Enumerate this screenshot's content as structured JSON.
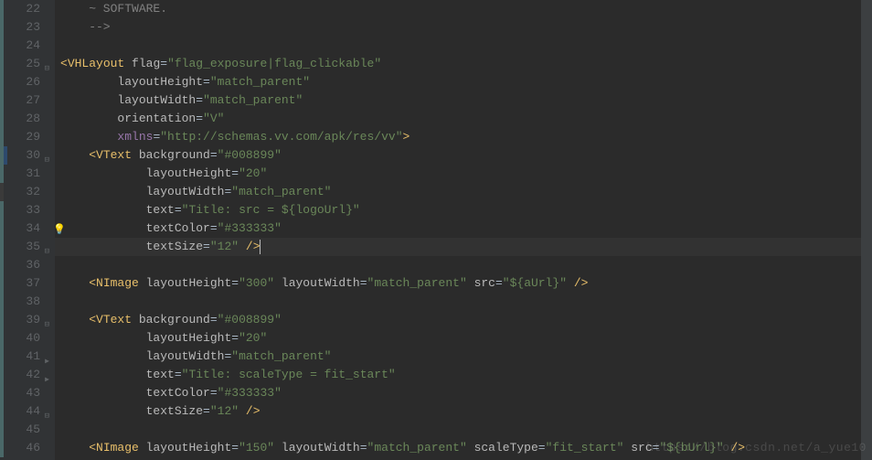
{
  "lines": [
    {
      "num": "22",
      "content": [
        {
          "t": "    ~ SOFTWARE.",
          "c": "comment"
        }
      ],
      "bar": "teal"
    },
    {
      "num": "23",
      "content": [
        {
          "t": "    -->",
          "c": "comment"
        }
      ],
      "bar": "teal"
    },
    {
      "num": "24",
      "content": [
        {
          "t": "",
          "c": ""
        }
      ],
      "bar": "teal"
    },
    {
      "num": "25",
      "content": [
        {
          "t": "<",
          "c": "tag"
        },
        {
          "t": "VHLayout",
          "c": "tag"
        },
        {
          "t": " ",
          "c": ""
        },
        {
          "t": "flag",
          "c": "attr-name"
        },
        {
          "t": "=",
          "c": "attr-eq"
        },
        {
          "t": "\"flag_exposure|flag_clickable\"",
          "c": "attr-val"
        }
      ],
      "bar": "teal",
      "fold": "down"
    },
    {
      "num": "26",
      "content": [
        {
          "t": "        ",
          "c": ""
        },
        {
          "t": "layoutHeight",
          "c": "attr-name"
        },
        {
          "t": "=",
          "c": "attr-eq"
        },
        {
          "t": "\"match_parent\"",
          "c": "attr-val"
        }
      ],
      "bar": "teal"
    },
    {
      "num": "27",
      "content": [
        {
          "t": "        ",
          "c": ""
        },
        {
          "t": "layoutWidth",
          "c": "attr-name"
        },
        {
          "t": "=",
          "c": "attr-eq"
        },
        {
          "t": "\"match_parent\"",
          "c": "attr-val"
        }
      ],
      "bar": "teal"
    },
    {
      "num": "28",
      "content": [
        {
          "t": "        ",
          "c": ""
        },
        {
          "t": "orientation",
          "c": "attr-name"
        },
        {
          "t": "=",
          "c": "attr-eq"
        },
        {
          "t": "\"V\"",
          "c": "attr-val"
        }
      ],
      "bar": "teal"
    },
    {
      "num": "29",
      "content": [
        {
          "t": "        ",
          "c": ""
        },
        {
          "t": "xmlns",
          "c": "ns"
        },
        {
          "t": "=",
          "c": "attr-eq"
        },
        {
          "t": "\"http://schemas.vv.com/apk/res/vv\"",
          "c": "attr-val"
        },
        {
          "t": ">",
          "c": "tag"
        }
      ],
      "bar": "teal"
    },
    {
      "num": "30",
      "content": [
        {
          "t": "    <",
          "c": "tag"
        },
        {
          "t": "VText",
          "c": "tag"
        },
        {
          "t": " ",
          "c": ""
        },
        {
          "t": "background",
          "c": "attr-name"
        },
        {
          "t": "=",
          "c": "attr-eq"
        },
        {
          "t": "\"#008899\"",
          "c": "attr-val"
        }
      ],
      "bar": "teal",
      "bar2": "blue",
      "fold": "down"
    },
    {
      "num": "31",
      "content": [
        {
          "t": "            ",
          "c": ""
        },
        {
          "t": "layoutHeight",
          "c": "attr-name"
        },
        {
          "t": "=",
          "c": "attr-eq"
        },
        {
          "t": "\"20\"",
          "c": "attr-val"
        }
      ],
      "bar": "teal"
    },
    {
      "num": "32",
      "content": [
        {
          "t": "            ",
          "c": ""
        },
        {
          "t": "layoutWidth",
          "c": "attr-name"
        },
        {
          "t": "=",
          "c": "attr-eq"
        },
        {
          "t": "\"match_parent\"",
          "c": "attr-val"
        }
      ],
      "bar": "dark"
    },
    {
      "num": "33",
      "content": [
        {
          "t": "            ",
          "c": ""
        },
        {
          "t": "text",
          "c": "attr-name"
        },
        {
          "t": "=",
          "c": "attr-eq"
        },
        {
          "t": "\"Title: src = ${logoUrl}\"",
          "c": "attr-val"
        }
      ],
      "bar": "teal"
    },
    {
      "num": "34",
      "content": [
        {
          "t": "            ",
          "c": ""
        },
        {
          "t": "textColor",
          "c": "attr-name"
        },
        {
          "t": "=",
          "c": "attr-eq"
        },
        {
          "t": "\"#333333\"",
          "c": "attr-val"
        }
      ],
      "bar": "teal",
      "bulb": true
    },
    {
      "num": "35",
      "content": [
        {
          "t": "            ",
          "c": ""
        },
        {
          "t": "textSize",
          "c": "attr-name"
        },
        {
          "t": "=",
          "c": "attr-eq"
        },
        {
          "t": "\"12\"",
          "c": "attr-val"
        },
        {
          "t": " ",
          "c": ""
        },
        {
          "t": "/>",
          "c": "tag"
        }
      ],
      "bar": "teal",
      "fold": "up",
      "current": true,
      "caret": true
    },
    {
      "num": "36",
      "content": [
        {
          "t": "",
          "c": ""
        }
      ],
      "bar": "teal"
    },
    {
      "num": "37",
      "content": [
        {
          "t": "    <",
          "c": "tag"
        },
        {
          "t": "NImage",
          "c": "tag"
        },
        {
          "t": " ",
          "c": ""
        },
        {
          "t": "layoutHeight",
          "c": "attr-name"
        },
        {
          "t": "=",
          "c": "attr-eq"
        },
        {
          "t": "\"300\"",
          "c": "attr-val"
        },
        {
          "t": " ",
          "c": ""
        },
        {
          "t": "layoutWidth",
          "c": "attr-name"
        },
        {
          "t": "=",
          "c": "attr-eq"
        },
        {
          "t": "\"match_parent\"",
          "c": "attr-val"
        },
        {
          "t": " ",
          "c": ""
        },
        {
          "t": "src",
          "c": "attr-name"
        },
        {
          "t": "=",
          "c": "attr-eq"
        },
        {
          "t": "\"${aUrl}\"",
          "c": "attr-val"
        },
        {
          "t": " ",
          "c": ""
        },
        {
          "t": "/>",
          "c": "tag"
        }
      ],
      "bar": "teal"
    },
    {
      "num": "38",
      "content": [
        {
          "t": "",
          "c": ""
        }
      ],
      "bar": "teal"
    },
    {
      "num": "39",
      "content": [
        {
          "t": "    <",
          "c": "tag"
        },
        {
          "t": "VText",
          "c": "tag"
        },
        {
          "t": " ",
          "c": ""
        },
        {
          "t": "background",
          "c": "attr-name"
        },
        {
          "t": "=",
          "c": "attr-eq"
        },
        {
          "t": "\"#008899\"",
          "c": "attr-val"
        }
      ],
      "bar": "teal",
      "fold": "down"
    },
    {
      "num": "40",
      "content": [
        {
          "t": "            ",
          "c": ""
        },
        {
          "t": "layoutHeight",
          "c": "attr-name"
        },
        {
          "t": "=",
          "c": "attr-eq"
        },
        {
          "t": "\"20\"",
          "c": "attr-val"
        }
      ],
      "bar": "teal"
    },
    {
      "num": "41",
      "content": [
        {
          "t": "            ",
          "c": ""
        },
        {
          "t": "layoutWidth",
          "c": "attr-name"
        },
        {
          "t": "=",
          "c": "attr-eq"
        },
        {
          "t": "\"match_parent\"",
          "c": "attr-val"
        }
      ],
      "bar": "teal",
      "arrow": true
    },
    {
      "num": "42",
      "content": [
        {
          "t": "            ",
          "c": ""
        },
        {
          "t": "text",
          "c": "attr-name"
        },
        {
          "t": "=",
          "c": "attr-eq"
        },
        {
          "t": "\"Title: scaleType = fit_start\"",
          "c": "attr-val"
        }
      ],
      "bar": "teal",
      "arrow": true
    },
    {
      "num": "43",
      "content": [
        {
          "t": "            ",
          "c": ""
        },
        {
          "t": "textColor",
          "c": "attr-name"
        },
        {
          "t": "=",
          "c": "attr-eq"
        },
        {
          "t": "\"#333333\"",
          "c": "attr-val"
        }
      ],
      "bar": "teal"
    },
    {
      "num": "44",
      "content": [
        {
          "t": "            ",
          "c": ""
        },
        {
          "t": "textSize",
          "c": "attr-name"
        },
        {
          "t": "=",
          "c": "attr-eq"
        },
        {
          "t": "\"12\"",
          "c": "attr-val"
        },
        {
          "t": " ",
          "c": ""
        },
        {
          "t": "/>",
          "c": "tag"
        }
      ],
      "bar": "teal",
      "fold": "up"
    },
    {
      "num": "45",
      "content": [
        {
          "t": "",
          "c": ""
        }
      ],
      "bar": "teal"
    },
    {
      "num": "46",
      "content": [
        {
          "t": "    <",
          "c": "tag"
        },
        {
          "t": "NImage",
          "c": "tag"
        },
        {
          "t": " ",
          "c": ""
        },
        {
          "t": "layoutHeight",
          "c": "attr-name"
        },
        {
          "t": "=",
          "c": "attr-eq"
        },
        {
          "t": "\"150\"",
          "c": "attr-val"
        },
        {
          "t": " ",
          "c": ""
        },
        {
          "t": "layoutWidth",
          "c": "attr-name"
        },
        {
          "t": "=",
          "c": "attr-eq"
        },
        {
          "t": "\"match_parent\"",
          "c": "attr-val"
        },
        {
          "t": " ",
          "c": ""
        },
        {
          "t": "scaleType",
          "c": "attr-name"
        },
        {
          "t": "=",
          "c": "attr-eq"
        },
        {
          "t": "\"fit_start\"",
          "c": "attr-val"
        },
        {
          "t": " ",
          "c": ""
        },
        {
          "t": "src",
          "c": "attr-name"
        },
        {
          "t": "=",
          "c": "attr-eq"
        },
        {
          "t": "\"${bUrl}\"",
          "c": "attr-val"
        },
        {
          "t": " ",
          "c": ""
        },
        {
          "t": "/>",
          "c": "tag"
        }
      ],
      "bar": "teal"
    }
  ],
  "watermark": "https://blog.csdn.net/a_yue10"
}
